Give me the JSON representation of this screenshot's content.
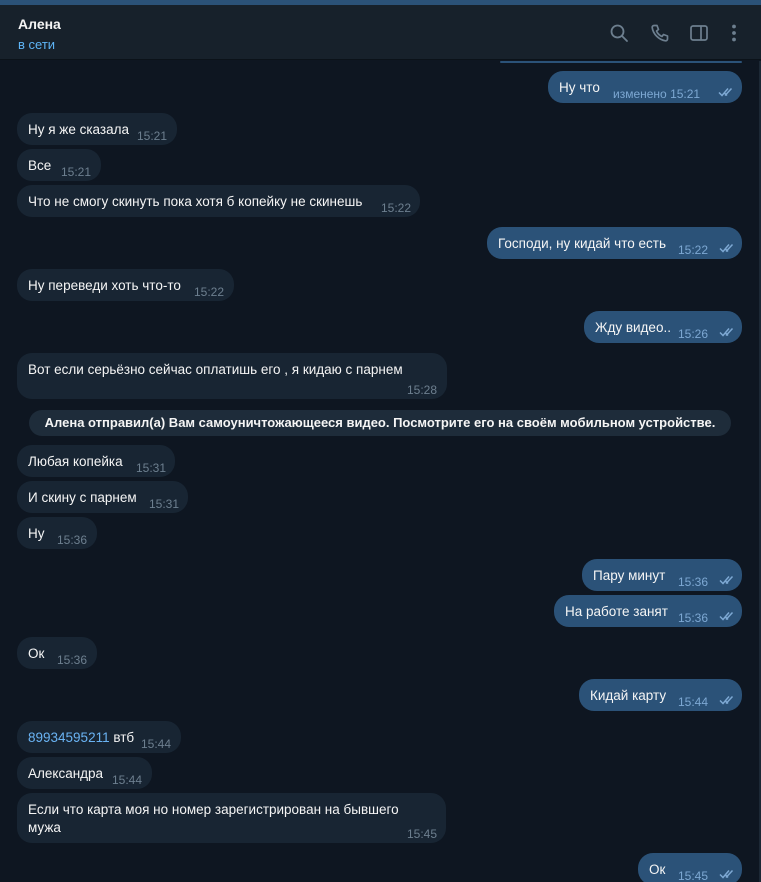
{
  "header": {
    "name": "Алена",
    "status": "в сети",
    "icons": [
      "search-icon",
      "phone-icon",
      "sidebar-toggle-icon",
      "more-vertical-icon"
    ]
  },
  "messages": [
    {
      "dir": "out",
      "text": "Ну что",
      "meta": "изменено 15:21"
    },
    {
      "dir": "in",
      "text": "Ну я же сказала",
      "time": "15:21"
    },
    {
      "dir": "in",
      "text": "Все",
      "time": "15:21"
    },
    {
      "dir": "in",
      "text": "Что не смогу скинуть пока хотя б копейку не скинешь",
      "time": "15:22"
    },
    {
      "dir": "out",
      "text": "Господи, ну кидай что есть",
      "time": "15:22"
    },
    {
      "dir": "in",
      "text": "Ну переведи хоть что-то",
      "time": "15:22"
    },
    {
      "dir": "out",
      "text": "Жду видео..",
      "time": "15:26"
    },
    {
      "dir": "in",
      "text": "Вот если серьёзно сейчас оплатишь его , я кидаю с парнем",
      "time": "15:28"
    },
    {
      "dir": "in",
      "text": "Любая копейка",
      "time": "15:31"
    },
    {
      "dir": "in",
      "text": "И скину с парнем",
      "time": "15:31"
    },
    {
      "dir": "in",
      "text": "Ну",
      "time": "15:36"
    },
    {
      "dir": "out",
      "text": "Пару минут",
      "time": "15:36"
    },
    {
      "dir": "out",
      "text": "На работе занят",
      "time": "15:36"
    },
    {
      "dir": "in",
      "text": "Ок",
      "time": "15:36"
    },
    {
      "dir": "out",
      "text": "Кидай карту",
      "time": "15:44"
    },
    {
      "dir": "in",
      "link": "89934595211",
      "text": " втб",
      "time": "15:44"
    },
    {
      "dir": "in",
      "text": "Александра",
      "time": "15:44"
    },
    {
      "dir": "in",
      "line1": "Если что карта моя но номер зарегистрирован на бывшего",
      "line2": "мужа",
      "time": "15:45"
    },
    {
      "dir": "out",
      "text": "Ок",
      "time": "15:45"
    }
  ],
  "service_message": "Алена отправил(а) Вам самоуничтожающееся видео. Посмотрите его на своём мобильном устройстве.",
  "colors": {
    "background": "#0e1621",
    "header": "#17212b",
    "incoming_bubble": "#182533",
    "outgoing_bubble": "#2b5278",
    "status_online": "#5eb5f7",
    "link": "#6ab3f3"
  }
}
